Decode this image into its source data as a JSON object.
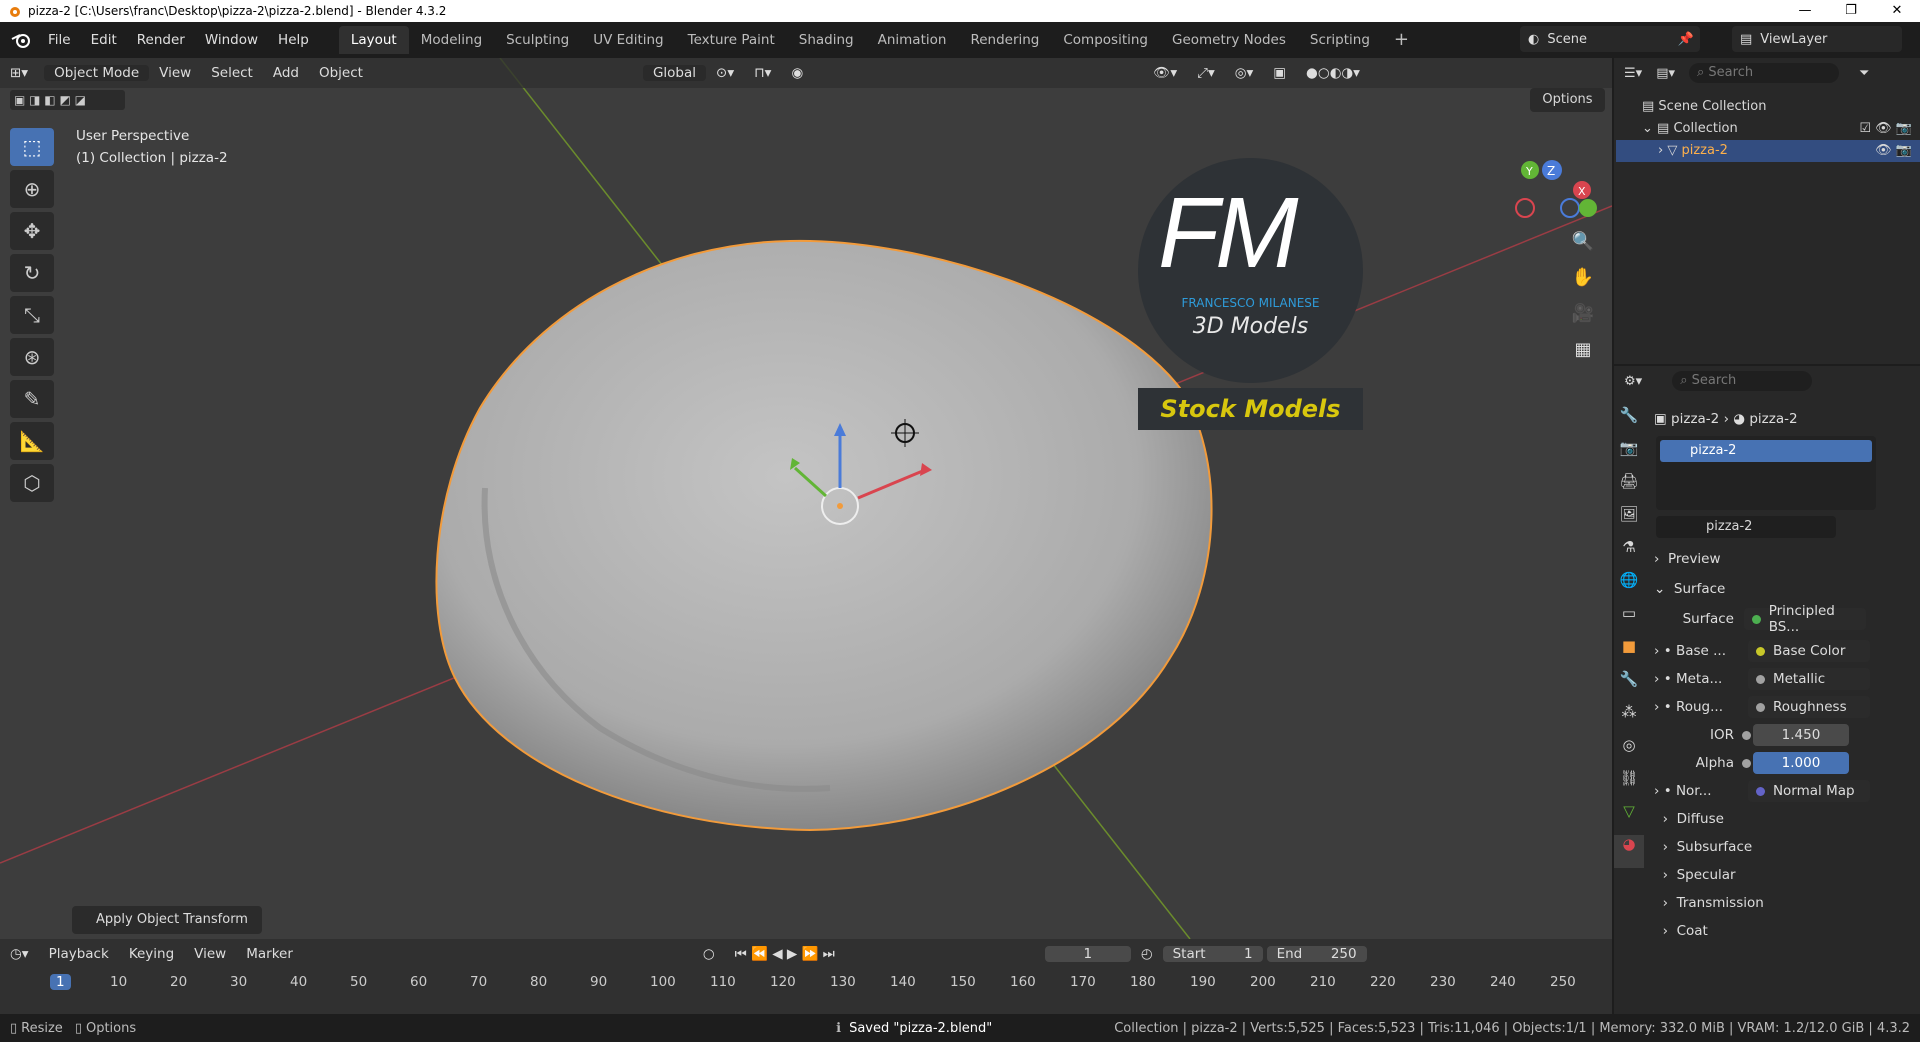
{
  "window": {
    "title": "pizza-2 [C:\\Users\\franc\\Desktop\\pizza-2\\pizza-2.blend] - Blender 4.3.2",
    "min": "—",
    "max": "❐",
    "close": "✕"
  },
  "menu": [
    "File",
    "Edit",
    "Render",
    "Window",
    "Help"
  ],
  "workspaces": [
    "Layout",
    "Modeling",
    "Sculpting",
    "UV Editing",
    "Texture Paint",
    "Shading",
    "Animation",
    "Rendering",
    "Compositing",
    "Geometry Nodes",
    "Scripting"
  ],
  "scene": "Scene",
  "view_layer": "ViewLayer",
  "viewport": {
    "mode": "Object Mode",
    "menus": [
      "View",
      "Select",
      "Add",
      "Object"
    ],
    "transform_orientation": "Global",
    "options": "Options",
    "perspective": "User Perspective",
    "collection_info": "(1) Collection | pizza-2",
    "apply_op": "Apply Object Transform",
    "gizmo": {
      "x": "X",
      "y": "Y",
      "z": "Z"
    }
  },
  "watermark": {
    "logo": "FM",
    "name": "FRANCESCO MILANESE",
    "subtitle": "3D Models",
    "banner": "Stock Models"
  },
  "timeline": {
    "menus": [
      "Playback",
      "Keying",
      "View",
      "Marker"
    ],
    "current_frame": "1",
    "start_label": "Start",
    "start": "1",
    "end_label": "End",
    "end": "250",
    "ticks": [
      "1",
      "10",
      "20",
      "30",
      "40",
      "50",
      "60",
      "70",
      "80",
      "90",
      "100",
      "110",
      "120",
      "130",
      "140",
      "150",
      "160",
      "170",
      "180",
      "190",
      "200",
      "210",
      "220",
      "230",
      "240",
      "250"
    ]
  },
  "status": {
    "resize": "Resize",
    "options": "Options",
    "saved": "Saved \"pizza-2.blend\"",
    "stats": "Collection | pizza-2 | Verts:5,525 | Faces:5,523 | Tris:11,046 | Objects:1/1 | Memory: 332.0 MiB | VRAM: 1.2/12.0 GiB | 4.3.2"
  },
  "outliner": {
    "search_placeholder": "Search",
    "scene_collection": "Scene Collection",
    "collection": "Collection",
    "object": "pizza-2"
  },
  "properties": {
    "search_placeholder": "Search",
    "breadcrumb_obj": "pizza-2",
    "breadcrumb_mat": "pizza-2",
    "slot": "pizza-2",
    "material_name": "pizza-2",
    "preview": "Preview",
    "surface_panel": "Surface",
    "surface_label": "Surface",
    "surface_value": "Principled BS...",
    "inputs": [
      {
        "label": "Base ...",
        "value": "Base Color",
        "sock": "#c7c729"
      },
      {
        "label": "Meta...",
        "value": "Metallic",
        "sock": "#a1a1a1"
      },
      {
        "label": "Roug...",
        "value": "Roughness",
        "sock": "#a1a1a1"
      }
    ],
    "ior_label": "IOR",
    "ior": "1.450",
    "alpha_label": "Alpha",
    "alpha": "1.000",
    "normal_label": "Nor...",
    "normal_value": "Normal Map",
    "panels": [
      "Diffuse",
      "Subsurface",
      "Specular",
      "Transmission",
      "Coat"
    ]
  }
}
